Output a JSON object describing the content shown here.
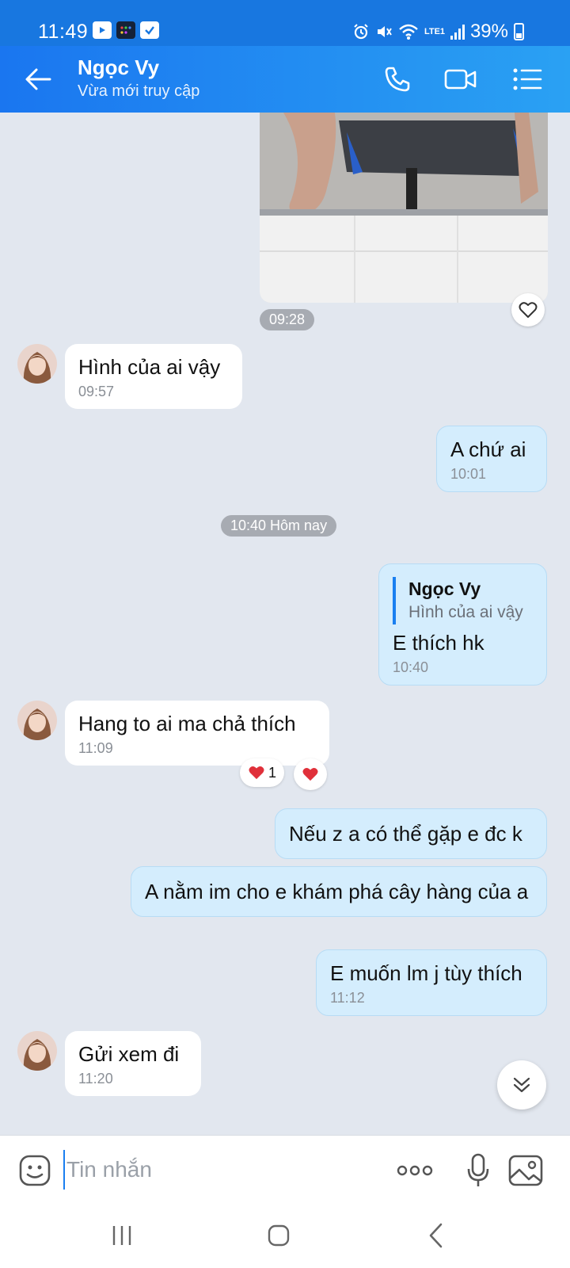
{
  "status_bar": {
    "time": "11:49",
    "battery": "39%",
    "network": "LTE1"
  },
  "header": {
    "contact_name": "Ngọc Vy",
    "contact_status": "Vừa mới truy cập"
  },
  "colors": {
    "header_start": "#1a76f0",
    "header_end": "#2aa1f3",
    "outgoing_bubble": "#d4edfd",
    "incoming_bubble": "#ffffff",
    "chat_background": "#e2e7ef",
    "accent": "#1a7ff0"
  },
  "chat": {
    "photo_time": "09:28",
    "date_separator": "10:40 Hôm nay",
    "messages": [
      {
        "direction": "in",
        "text": "Hình của ai vậy",
        "time": "09:57"
      },
      {
        "direction": "out",
        "text": "A chứ ai",
        "time": "10:01"
      },
      {
        "direction": "out",
        "quote": {
          "name": "Ngọc Vy",
          "text": "Hình của ai vậy"
        },
        "text": "E thích hk",
        "time": "10:40"
      },
      {
        "direction": "in",
        "text": "Hang to ai ma chả thích",
        "time": "11:09",
        "reaction_count": "1"
      },
      {
        "direction": "out",
        "text": "Nếu z a có thể gặp e đc k"
      },
      {
        "direction": "out",
        "text": "A nằm im cho e khám phá cây hàng của a"
      },
      {
        "direction": "out",
        "text": "E muốn lm j tùy thích",
        "time": "11:12"
      },
      {
        "direction": "in",
        "text": "Gửi xem đi",
        "time": "11:20"
      }
    ]
  },
  "input": {
    "placeholder": "Tin nhắn"
  },
  "icons": {
    "back": "arrow-left-icon",
    "call": "phone-icon",
    "video": "video-camera-icon",
    "menu": "list-menu-icon",
    "heart": "heart-outline-icon",
    "emoji": "sticker-smile-icon",
    "more": "more-dots-icon",
    "mic": "microphone-icon",
    "gallery": "image-gallery-icon",
    "scroll_down": "double-chevron-down-icon"
  }
}
